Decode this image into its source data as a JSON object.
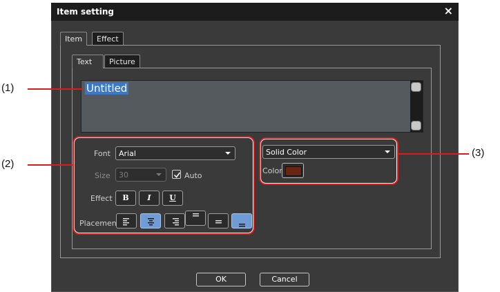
{
  "dialog": {
    "title": "Item setting",
    "close_glyph": "×"
  },
  "outer_tabs": [
    {
      "label": "Item"
    },
    {
      "label": "Effect"
    }
  ],
  "inner_tabs": [
    {
      "label": "Text"
    },
    {
      "label": "Picture"
    }
  ],
  "text_field": {
    "value": "Untitled"
  },
  "font": {
    "label": "Font",
    "value": "Arial"
  },
  "size": {
    "label": "Size",
    "value": "30",
    "auto_label": "Auto",
    "auto_checked": true
  },
  "effect": {
    "label": "Effect",
    "bold": "B",
    "italic": "I",
    "underline": "U"
  },
  "placement": {
    "label": "Placement",
    "selected": [
      "align-center",
      "position-bottom"
    ]
  },
  "fill": {
    "type_value": "Solid Color",
    "color_label": "Color",
    "swatch_color": "#6b2410"
  },
  "buttons": {
    "ok": "OK",
    "cancel": "Cancel"
  },
  "annotations": {
    "a1": "(1)",
    "a2": "(2)",
    "a3": "(3)"
  },
  "colors": {
    "callout": "#e01919",
    "selected_button": "#6f9bd6",
    "text_selection": "#3c78c8"
  },
  "icons": [
    "close-icon",
    "scroll-up-icon",
    "scroll-down-icon",
    "chevron-down-icon",
    "checkmark-icon",
    "align-left-icon",
    "align-center-icon",
    "align-right-icon",
    "position-top-icon",
    "position-middle-icon",
    "position-bottom-icon"
  ]
}
